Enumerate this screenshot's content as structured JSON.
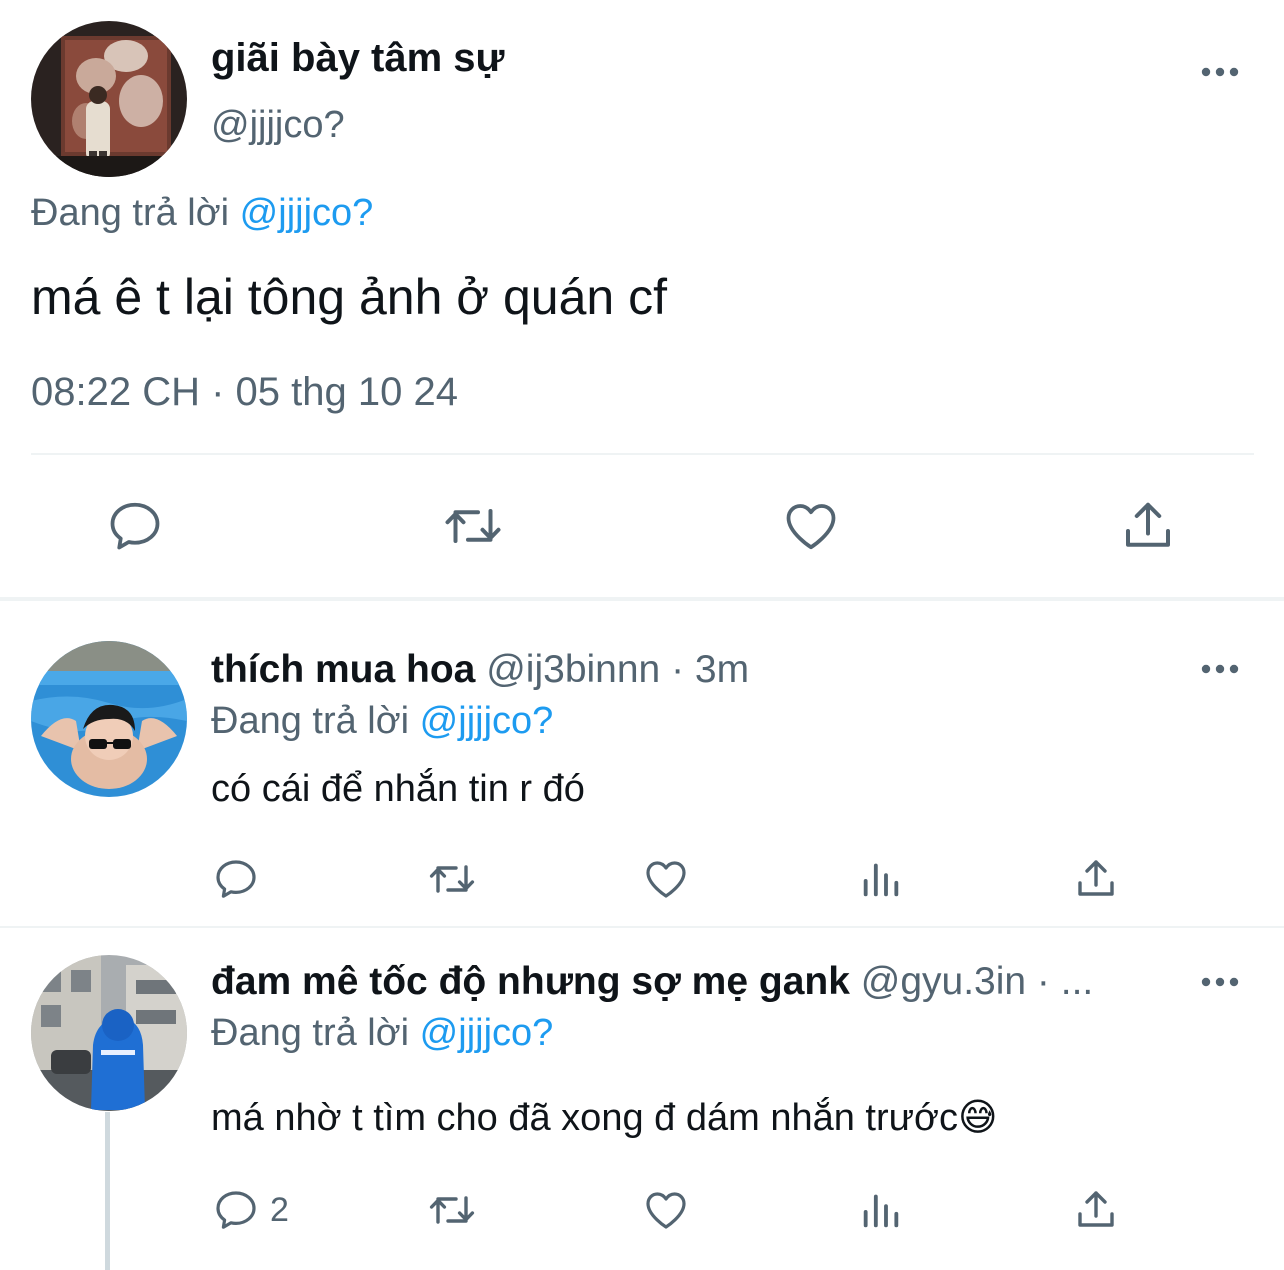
{
  "main_tweet": {
    "display_name": "giãi bày tâm sự",
    "handle": "@jjjjco?",
    "reply_prefix": "Đang trả lời",
    "reply_mention": "@jjjjco?",
    "text": "má ê t lại tông ảnh ở quán cf",
    "timestamp": "08:22 CH · 05 thg 10 24",
    "avatar_icon": "painting-avatar"
  },
  "replies": [
    {
      "display_name": "thích mua hoa",
      "meta": "@ij3binnn · 3m",
      "reply_prefix": "Đang trả lời",
      "reply_mention": "@jjjjco?",
      "text": "có cái để nhắn tin r đó",
      "reply_count": "",
      "avatar_icon": "pool-avatar"
    },
    {
      "display_name": "đam mê tốc độ nhưng sợ mẹ gank",
      "meta": "@gyu.3in · ...",
      "reply_prefix": "Đang trả lời",
      "reply_mention": "@jjjjco?",
      "text": "má nhờ t tìm cho đã xong đ dám nhắn trước😅",
      "reply_count": "2",
      "avatar_icon": "street-avatar"
    }
  ],
  "colors": {
    "accent": "#1d9bf0",
    "secondary_text": "#536471",
    "divider": "#eff3f4"
  }
}
